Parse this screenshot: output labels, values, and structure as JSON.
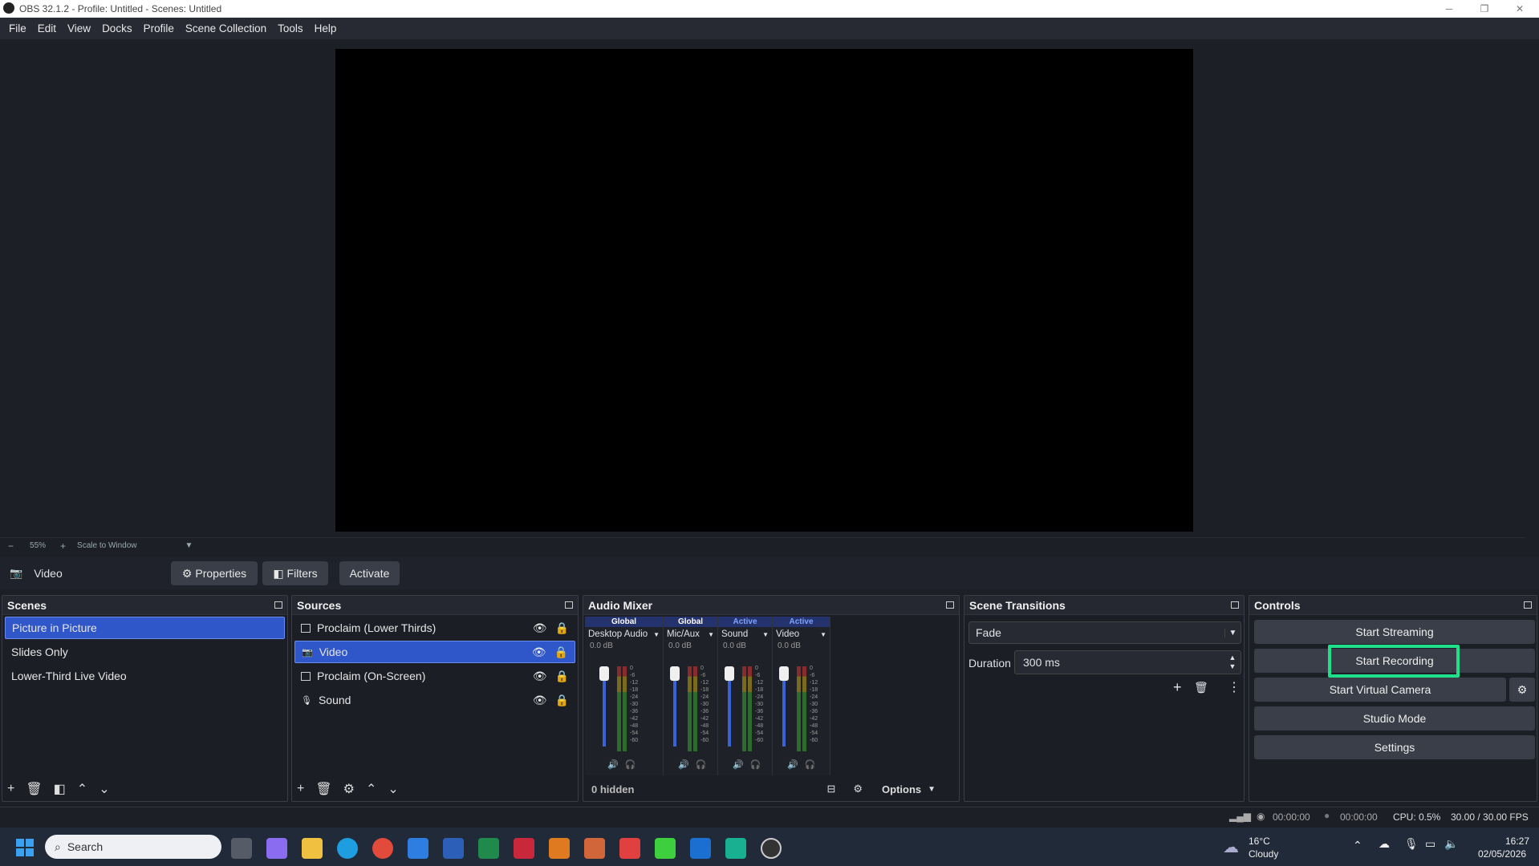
{
  "window": {
    "title": "OBS 32.1.2 - Profile: Untitled - Scenes: Untitled",
    "minimize": "─",
    "restore": "❐",
    "close": "✕"
  },
  "menu": [
    "File",
    "Edit",
    "View",
    "Docks",
    "Profile",
    "Scene Collection",
    "Tools",
    "Help"
  ],
  "zoom": {
    "minus": "−",
    "value": "55%",
    "plus": "+",
    "mode": "Scale to Window"
  },
  "source_toolbar": {
    "selected_source": "Video",
    "properties": "Properties",
    "filters": "Filters",
    "activate": "Activate"
  },
  "scenes": {
    "title": "Scenes",
    "items": [
      "Picture in Picture",
      "Slides Only",
      "Lower-Third Live Video"
    ],
    "selected": 0
  },
  "sources": {
    "title": "Sources",
    "items": [
      {
        "name": "Proclaim (Lower Thirds)",
        "icon": "window-icon"
      },
      {
        "name": "Video",
        "icon": "camera-icon"
      },
      {
        "name": "Proclaim (On-Screen)",
        "icon": "window-icon"
      },
      {
        "name": "Sound",
        "icon": "microphone-icon"
      }
    ],
    "selected": 1
  },
  "audio_mixer": {
    "title": "Audio Mixer",
    "channels": [
      {
        "badge": "Global",
        "name": "Desktop Audio",
        "db": "0.0 dB",
        "level": 0.3
      },
      {
        "badge": "Global",
        "name": "Mic/Aux",
        "db": "0.0 dB",
        "level": 0.3
      },
      {
        "badge": "Active",
        "name": "Sound",
        "db": "0.0 dB",
        "level": 0.3
      },
      {
        "badge": "Active",
        "name": "Video",
        "db": "0.0 dB",
        "level": 0.3
      }
    ],
    "scale": [
      "0",
      "-6",
      "-12",
      "-18",
      "-24",
      "-30",
      "-36",
      "-42",
      "-48",
      "-54",
      "-60"
    ],
    "hidden": "0 hidden",
    "options": "Options"
  },
  "transitions": {
    "title": "Scene Transitions",
    "type": "Fade",
    "duration_label": "Duration",
    "duration": "300 ms"
  },
  "controls": {
    "title": "Controls",
    "start_streaming": "Start Streaming",
    "start_recording": "Start Recording",
    "start_virtual_camera": "Start Virtual Camera",
    "studio_mode": "Studio Mode",
    "settings": "Settings"
  },
  "status": {
    "stream_time": "00:00:00",
    "rec_time": "00:00:00",
    "cpu": "CPU: 0.5%",
    "fps": "30.00 / 30.00 FPS"
  },
  "taskbar": {
    "search": "Search",
    "weather_temp": "16°C",
    "weather_desc": "Cloudy",
    "time": "16:27",
    "date": "02/05/2026"
  },
  "colors": {
    "accent": "#2f57c9",
    "highlight": "#1fe08a",
    "panel": "#1c1e25"
  }
}
